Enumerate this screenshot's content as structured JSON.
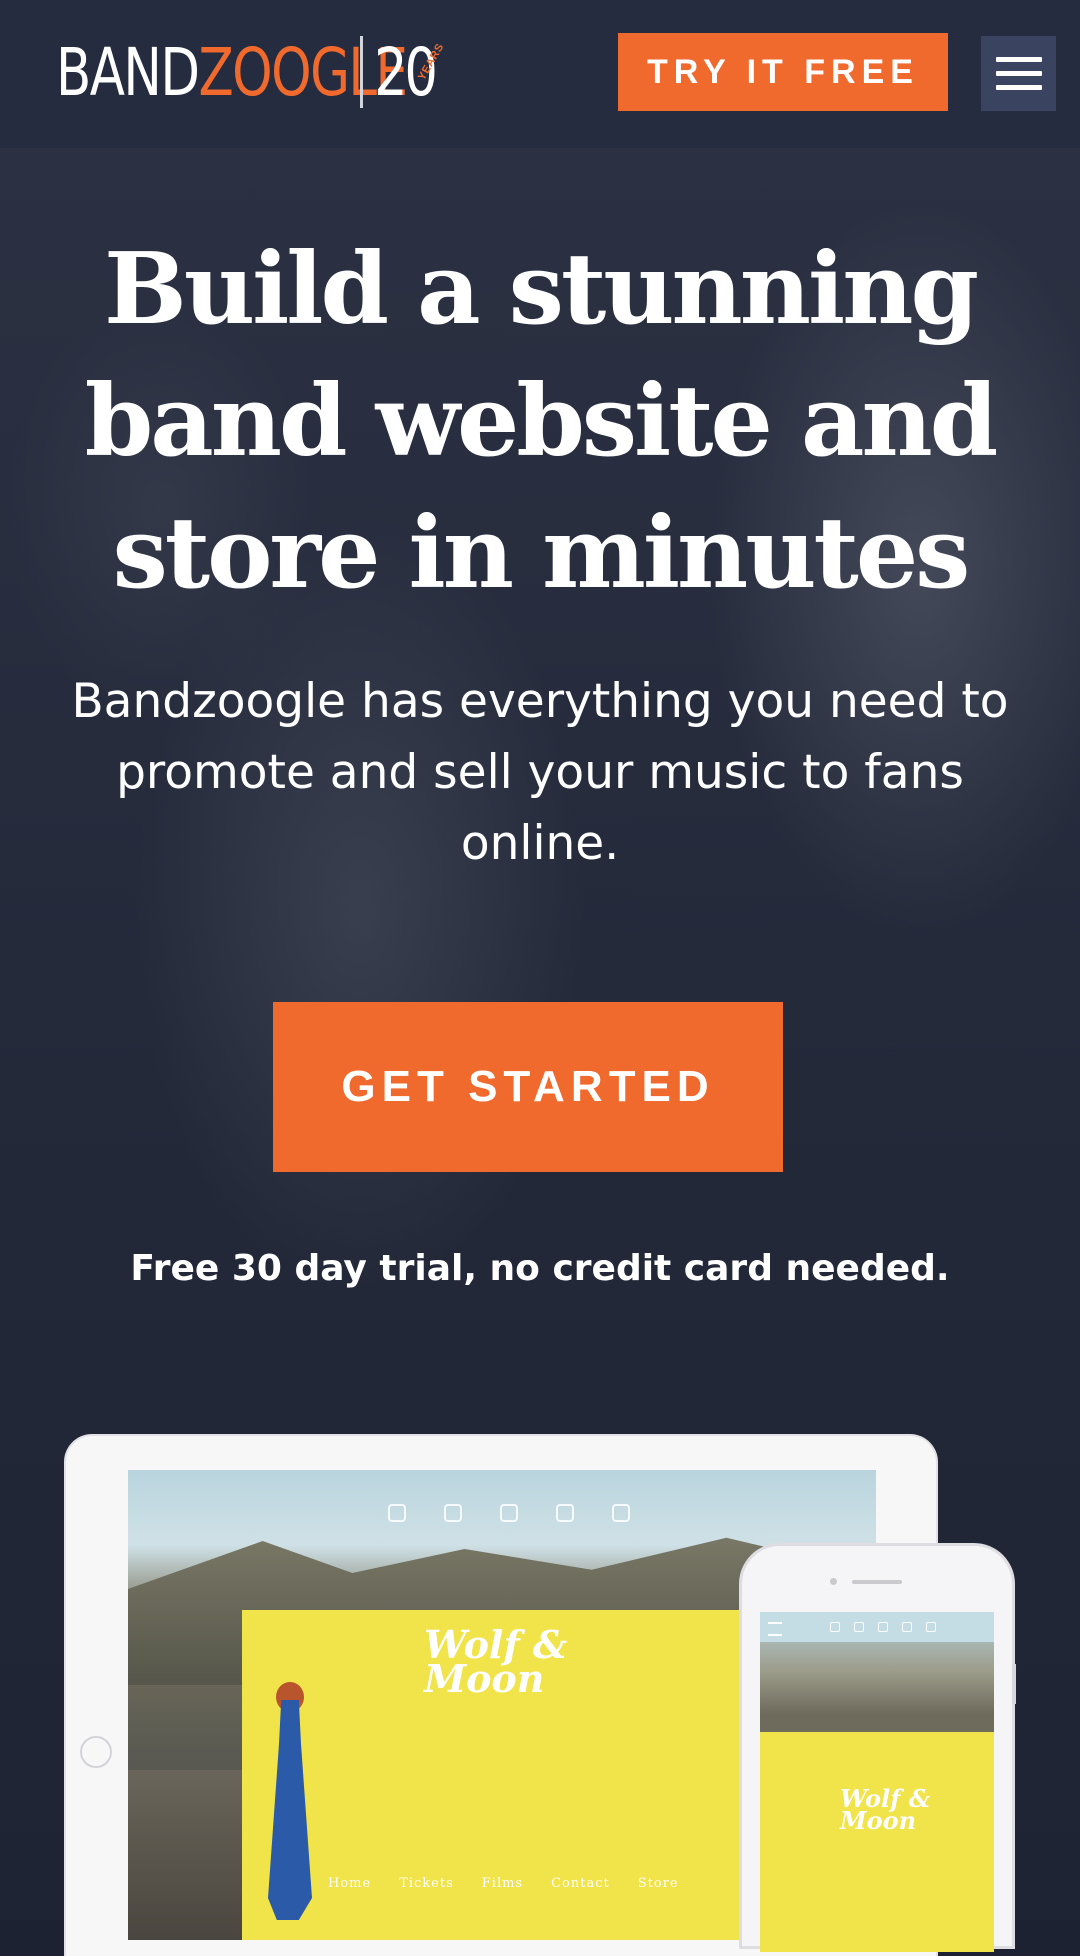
{
  "header": {
    "logo_band": "BAND",
    "logo_zoogle": "ZOOGLE",
    "logo_anniversary": "20",
    "logo_years": "YEARS",
    "cta_label": "TRY IT FREE",
    "menu_icon": "hamburger-icon"
  },
  "hero": {
    "headline": "Build a stunning band website and store in minutes",
    "subtext": "Bandzoogle has everything you need to promote and sell your music to fans online.",
    "cta_label": "GET STARTED",
    "trial_note": "Free 30 day trial, no credit card needed."
  },
  "mockup": {
    "band_name_line1": "Wolf &",
    "band_name_line2": "Moon",
    "nav_items": [
      "Home",
      "Tickets",
      "Films",
      "Contact",
      "Store"
    ],
    "social_icons": [
      "instagram-icon",
      "facebook-icon",
      "youtube-icon",
      "music-icon",
      "spotify-icon"
    ]
  },
  "colors": {
    "accent": "#f0692d",
    "header_bg": "#252c3f",
    "hero_bg": "#222838",
    "yellow": "#f1e34a"
  }
}
